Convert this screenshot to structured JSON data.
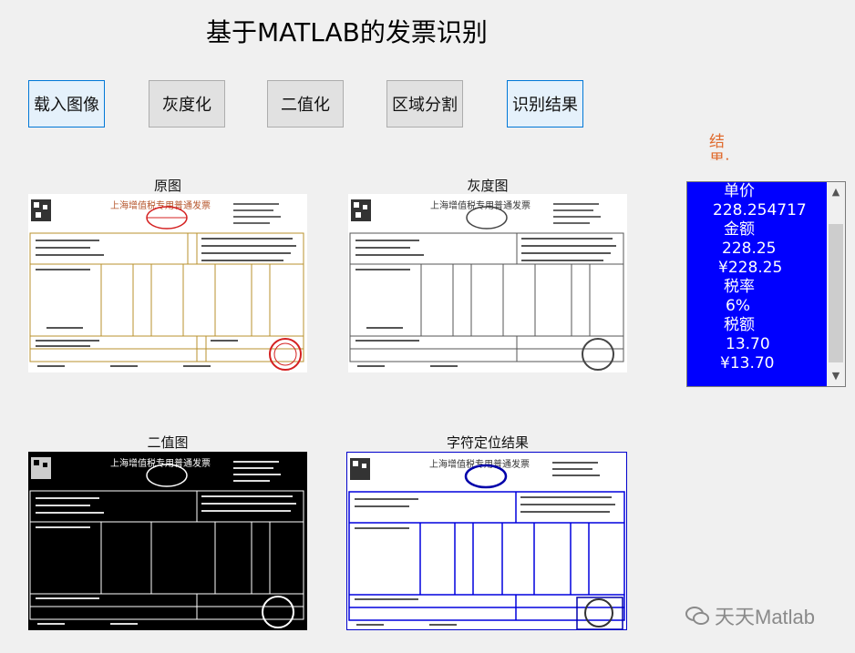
{
  "title": "基于MATLAB的发票识别",
  "buttons": {
    "load": "载入图像",
    "gray": "灰度化",
    "binary": "二值化",
    "segment": "区域分割",
    "result": "识别结果"
  },
  "captions": {
    "original": "原图",
    "gray": "灰度图",
    "binary": "二值图",
    "locate": "字符定位结果"
  },
  "invoice": {
    "header": "上海增值税专用普通发票"
  },
  "result_label": "结果:",
  "result_list": {
    "items": [
      "单价",
      "228.254717",
      "金额",
      "228.25",
      "¥228.25",
      "税率",
      "6%",
      "税额",
      "13.70",
      "¥13.70"
    ]
  },
  "watermark": "天天Matlab",
  "icons": {
    "scroll_up": "chevron-up-icon",
    "scroll_down": "chevron-down-icon",
    "wechat": "wechat-icon"
  }
}
